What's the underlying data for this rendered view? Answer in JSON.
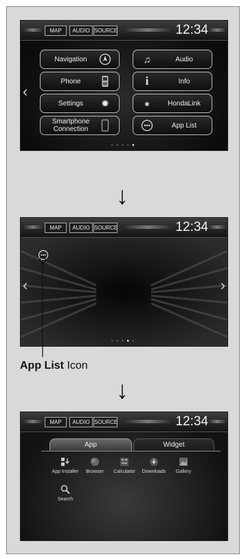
{
  "topbar": {
    "map": "MAP",
    "audio": "AUDIO",
    "source": "SOURCE",
    "clock": "12:34"
  },
  "home_menu": {
    "navigation": "Navigation",
    "phone": "Phone",
    "settings": "Settings",
    "smartphone": "Smartphone Connection",
    "audio": "Audio",
    "info": "Info",
    "hondalink": "HondaLink",
    "applist": "App List"
  },
  "callout": {
    "bold": "App List",
    "rest": " Icon"
  },
  "app_list": {
    "tab_app": "App",
    "tab_widget": "Widget",
    "apps": [
      {
        "label": "App Installer",
        "icon": "app-installer-icon"
      },
      {
        "label": "Browser",
        "icon": "globe-icon"
      },
      {
        "label": "Calculator",
        "icon": "calculator-icon"
      },
      {
        "label": "Downloads",
        "icon": "download-icon"
      },
      {
        "label": "Gallery",
        "icon": "gallery-icon"
      },
      {
        "label": "Search",
        "icon": "search-icon"
      }
    ]
  }
}
